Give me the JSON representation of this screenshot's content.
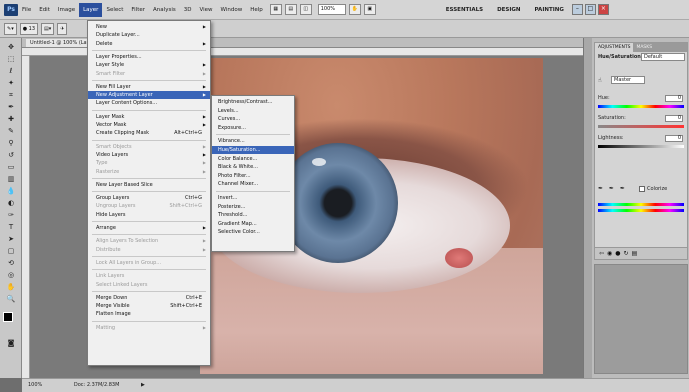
{
  "menubar": {
    "logo": "Ps",
    "items": [
      "File",
      "Edit",
      "Image",
      "Layer",
      "Select",
      "Filter",
      "Analysis",
      "3D",
      "View",
      "Window",
      "Help"
    ],
    "active_item": "Layer",
    "zoom": "100%",
    "workspaces": [
      "ESSENTIALS",
      "DESIGN",
      "PAINTING"
    ]
  },
  "optbar": {
    "doc_info": "Untitled-1 @ 100% (RGB/8)"
  },
  "document": {
    "tab_title": "Untitled-1 @ 100% (Layer 1, RGB/8)",
    "status_zoom": "100%",
    "status_doc": "Doc: 2.37M/2.83M"
  },
  "layer_menu": {
    "items": [
      {
        "label": "New",
        "arrow": true,
        "disabled": false
      },
      {
        "label": "Duplicate Layer...",
        "arrow": false,
        "disabled": false
      },
      {
        "label": "Delete",
        "arrow": true,
        "disabled": false
      },
      {
        "sep": true
      },
      {
        "label": "Layer Properties...",
        "arrow": false,
        "disabled": false
      },
      {
        "label": "Layer Style",
        "arrow": true,
        "disabled": false
      },
      {
        "label": "Smart Filter",
        "arrow": true,
        "disabled": true
      },
      {
        "sep": true
      },
      {
        "label": "New Fill Layer",
        "arrow": true,
        "disabled": false
      },
      {
        "label": "New Adjustment Layer",
        "arrow": true,
        "disabled": false,
        "highlight": true
      },
      {
        "label": "Layer Content Options...",
        "arrow": false,
        "disabled": false
      },
      {
        "sep": true
      },
      {
        "label": "Layer Mask",
        "arrow": true,
        "disabled": false
      },
      {
        "label": "Vector Mask",
        "arrow": true,
        "disabled": false
      },
      {
        "label": "Create Clipping Mask",
        "shortcut": "Alt+Ctrl+G",
        "arrow": false,
        "disabled": false
      },
      {
        "sep": true
      },
      {
        "label": "Smart Objects",
        "arrow": true,
        "disabled": true
      },
      {
        "label": "Video Layers",
        "arrow": true,
        "disabled": false
      },
      {
        "label": "Type",
        "arrow": true,
        "disabled": true
      },
      {
        "label": "Rasterize",
        "arrow": true,
        "disabled": true
      },
      {
        "sep": true
      },
      {
        "label": "New Layer Based Slice",
        "arrow": false,
        "disabled": false
      },
      {
        "sep": true
      },
      {
        "label": "Group Layers",
        "shortcut": "Ctrl+G",
        "arrow": false,
        "disabled": false
      },
      {
        "label": "Ungroup Layers",
        "shortcut": "Shift+Ctrl+G",
        "arrow": false,
        "disabled": true
      },
      {
        "label": "Hide Layers",
        "arrow": false,
        "disabled": false
      },
      {
        "sep": true
      },
      {
        "label": "Arrange",
        "arrow": true,
        "disabled": false
      },
      {
        "sep": true
      },
      {
        "label": "Align Layers To Selection",
        "arrow": true,
        "disabled": true
      },
      {
        "label": "Distribute",
        "arrow": true,
        "disabled": true
      },
      {
        "sep": true
      },
      {
        "label": "Lock All Layers in Group...",
        "arrow": false,
        "disabled": true
      },
      {
        "sep": true
      },
      {
        "label": "Link Layers",
        "arrow": false,
        "disabled": true
      },
      {
        "label": "Select Linked Layers",
        "arrow": false,
        "disabled": true
      },
      {
        "sep": true
      },
      {
        "label": "Merge Down",
        "shortcut": "Ctrl+E",
        "arrow": false,
        "disabled": false
      },
      {
        "label": "Merge Visible",
        "shortcut": "Shift+Ctrl+E",
        "arrow": false,
        "disabled": false
      },
      {
        "label": "Flatten Image",
        "arrow": false,
        "disabled": false
      },
      {
        "sep": true
      },
      {
        "label": "Matting",
        "arrow": true,
        "disabled": true
      }
    ]
  },
  "adjustment_submenu": {
    "items": [
      {
        "label": "Brightness/Contrast..."
      },
      {
        "label": "Levels..."
      },
      {
        "label": "Curves..."
      },
      {
        "label": "Exposure..."
      },
      {
        "sep": true
      },
      {
        "label": "Vibrance..."
      },
      {
        "label": "Hue/Saturation...",
        "highlight": true
      },
      {
        "label": "Color Balance..."
      },
      {
        "label": "Black & White..."
      },
      {
        "label": "Photo Filter..."
      },
      {
        "label": "Channel Mixer..."
      },
      {
        "sep": true
      },
      {
        "label": "Invert..."
      },
      {
        "label": "Posterize..."
      },
      {
        "label": "Threshold..."
      },
      {
        "label": "Gradient Map..."
      },
      {
        "label": "Selective Color..."
      }
    ]
  },
  "adjustments_panel": {
    "tabs": [
      "ADJUSTMENTS",
      "MASKS"
    ],
    "title": "Hue/Saturation",
    "preset": "Default",
    "channel": "Master",
    "hue_label": "Hue:",
    "hue_value": "0",
    "saturation_label": "Saturation:",
    "saturation_value": "0",
    "lightness_label": "Lightness:",
    "lightness_value": "0",
    "colorize_label": "Colorize"
  }
}
